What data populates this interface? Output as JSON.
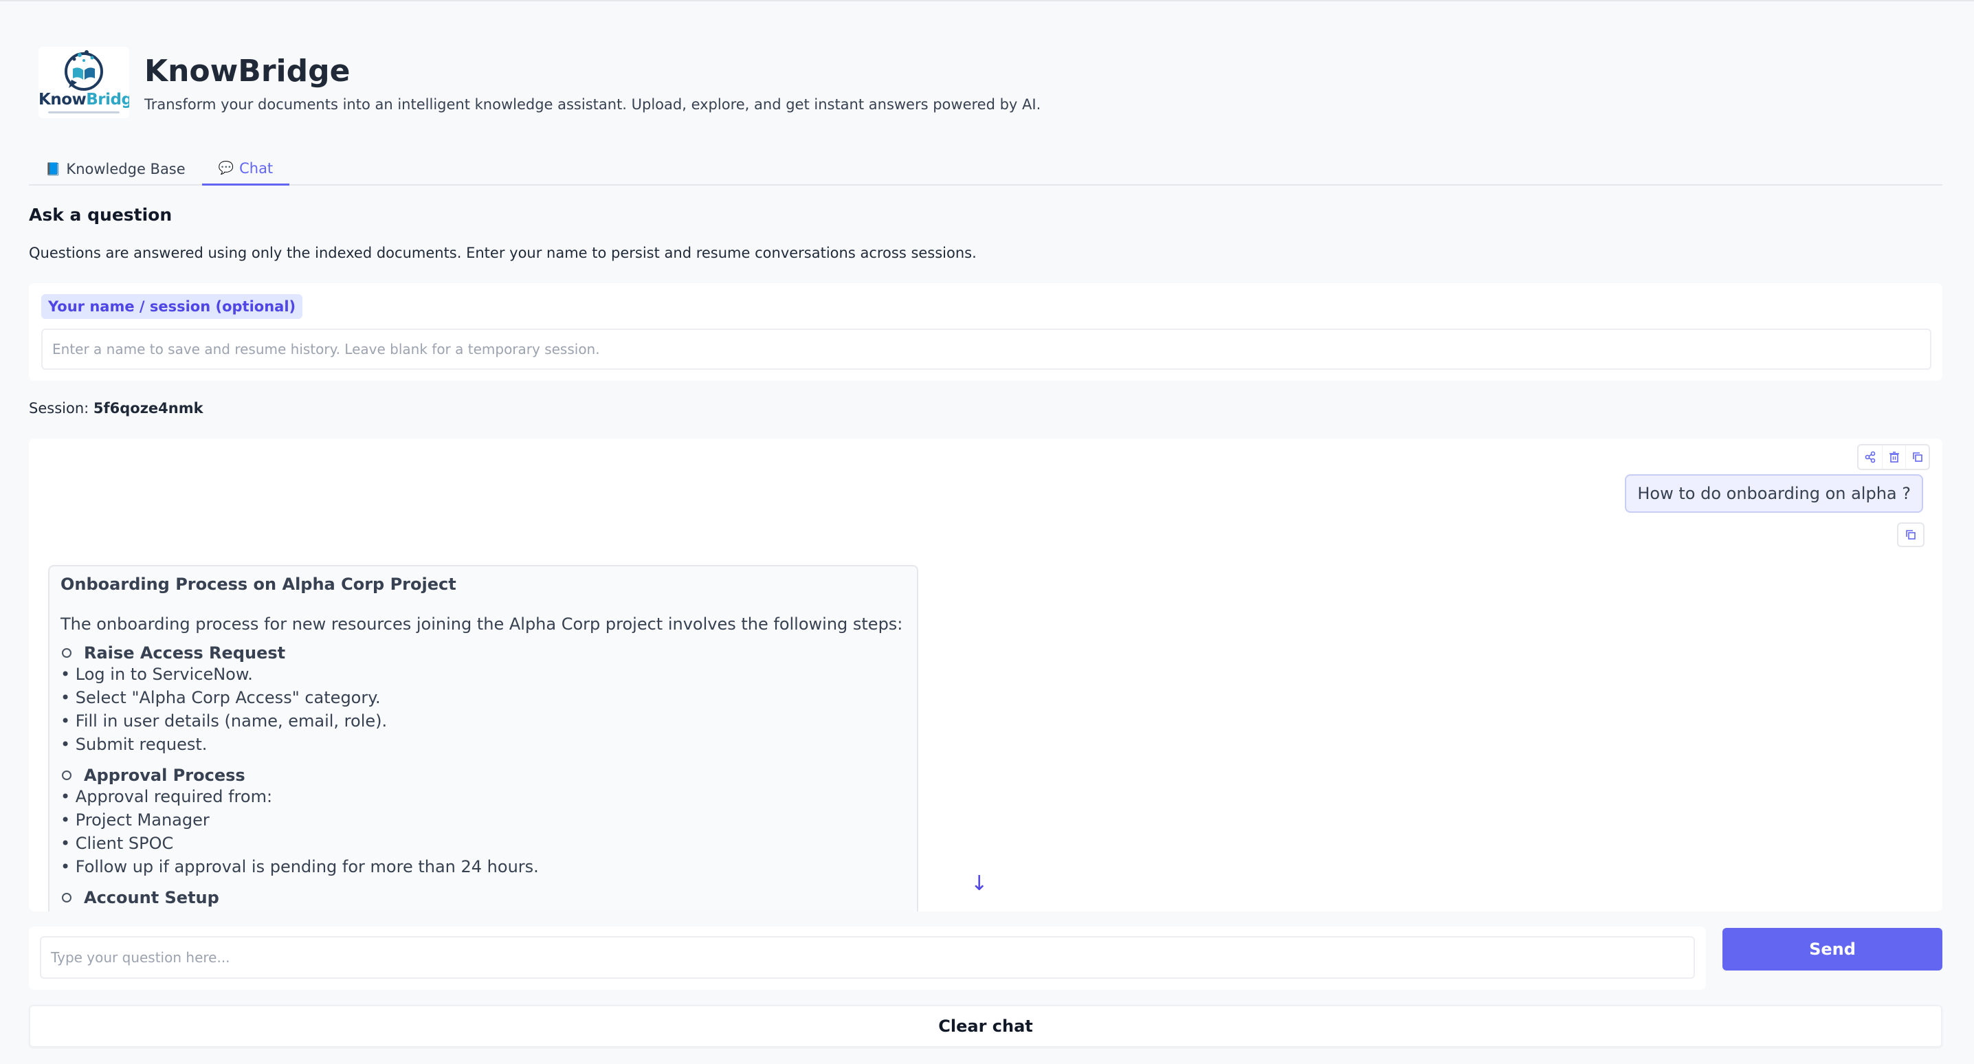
{
  "header": {
    "title": "KnowBridge",
    "subtitle": "Transform your documents into an intelligent knowledge assistant. Upload, explore, and get instant answers powered by AI.",
    "logo_text_a": "Know",
    "logo_text_b": "Bridge"
  },
  "tabs": [
    {
      "icon": "book-icon",
      "label": "Knowledge Base",
      "active": false
    },
    {
      "icon": "speech-bubble-icon",
      "label": "Chat",
      "active": true
    }
  ],
  "ask": {
    "title": "Ask a question",
    "description": "Questions are answered using only the indexed documents. Enter your name to persist and resume conversations across sessions."
  },
  "name_field": {
    "label": "Your name / session (optional)",
    "value": "",
    "placeholder": "Enter a name to save and resume history. Leave blank for a temporary session."
  },
  "session": {
    "label": "Session:",
    "id": "5f6qoze4nmk"
  },
  "chat": {
    "tools": [
      "share-icon",
      "trash-icon",
      "copy-icon"
    ],
    "user_message": "How to do onboarding on alpha ?",
    "bot": {
      "title": "Onboarding Process on Alpha Corp Project",
      "intro": "The onboarding process for new resources joining the Alpha Corp project involves the following steps:",
      "sections": [
        {
          "heading": "Raise Access Request",
          "lines": [
            "• Log in to ServiceNow.",
            "• Select \"Alpha Corp Access\" category.",
            "• Fill in user details (name, email, role).",
            "• Submit request."
          ]
        },
        {
          "heading": "Approval Process",
          "lines": [
            "• Approval required from:",
            "• Project Manager",
            "• Client SPOC",
            "• Follow up if approval is pending for more than 24 hours."
          ]
        },
        {
          "heading": "Account Setup",
          "lines": []
        }
      ]
    }
  },
  "question_input": {
    "value": "",
    "placeholder": "Type your question here..."
  },
  "buttons": {
    "send": "Send",
    "clear": "Clear chat"
  },
  "colors": {
    "accent": "#6366f1",
    "label_bg": "#e0e7ff",
    "user_bubble_bg": "#eef0ff"
  }
}
